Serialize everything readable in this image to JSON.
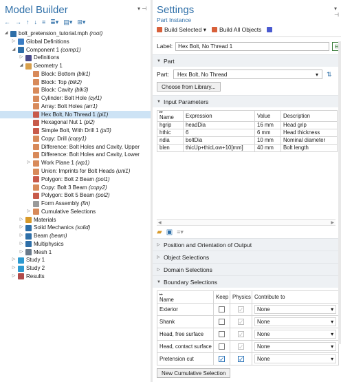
{
  "model_builder": {
    "title": "Model Builder",
    "toolbar": [
      "←",
      "→",
      "↑",
      "↓",
      "≡",
      "≣▾",
      "▤▾",
      "⊞▾"
    ],
    "tree": [
      {
        "label": "bolt_pretension_tutorial.mph",
        "tag": "(root)",
        "level": 0,
        "twisty": "◢",
        "icon": "mph-file-icon",
        "color": "#2e6fa8"
      },
      {
        "label": "Global Definitions",
        "tag": "",
        "level": 1,
        "twisty": "▷",
        "icon": "globe-icon",
        "color": "#3a7dc4"
      },
      {
        "label": "Component 1",
        "tag": "(comp1)",
        "level": 1,
        "twisty": "◢",
        "icon": "component-icon",
        "color": "#2e6fa8"
      },
      {
        "label": "Definitions",
        "tag": "",
        "level": 2,
        "twisty": "▷",
        "icon": "definitions-icon",
        "color": "#4a4a8a"
      },
      {
        "label": "Geometry 1",
        "tag": "",
        "level": 2,
        "twisty": "◢",
        "icon": "geometry-icon",
        "color": "#d8a04c"
      },
      {
        "label": "Block: Bottom",
        "tag": "(blk1)",
        "level": 3,
        "twisty": "",
        "icon": "block-icon",
        "color": "#d88a5a"
      },
      {
        "label": "Block: Top",
        "tag": "(blk2)",
        "level": 3,
        "twisty": "",
        "icon": "block-icon",
        "color": "#d88a5a"
      },
      {
        "label": "Block: Cavity",
        "tag": "(blk3)",
        "level": 3,
        "twisty": "",
        "icon": "block-icon",
        "color": "#d88a5a"
      },
      {
        "label": "Cylinder: Bolt Hole",
        "tag": "(cyl1)",
        "level": 3,
        "twisty": "",
        "icon": "cylinder-icon",
        "color": "#d88a5a"
      },
      {
        "label": "Array: Bolt Holes",
        "tag": "(arr1)",
        "level": 3,
        "twisty": "",
        "icon": "array-icon",
        "color": "#d88a5a"
      },
      {
        "label": "Hex Bolt, No Thread 1",
        "tag": "(pi1)",
        "level": 3,
        "twisty": "",
        "icon": "part-instance-icon",
        "color": "#c85a4a",
        "selected": true
      },
      {
        "label": "Hexagonal Nut 1",
        "tag": "(pi2)",
        "level": 3,
        "twisty": "",
        "icon": "part-instance-icon",
        "color": "#c85a4a"
      },
      {
        "label": "Simple Bolt, With Drill 1",
        "tag": "(pi3)",
        "level": 3,
        "twisty": "",
        "icon": "part-instance-icon",
        "color": "#c85a4a"
      },
      {
        "label": "Copy: Drill",
        "tag": "(copy1)",
        "level": 3,
        "twisty": "",
        "icon": "copy-icon",
        "color": "#d88a5a"
      },
      {
        "label": "Difference: Bolt Holes and Cavity, Upper",
        "tag": "",
        "level": 3,
        "twisty": "",
        "icon": "difference-icon",
        "color": "#d88a5a"
      },
      {
        "label": "Difference: Bolt Holes and Cavity, Lower",
        "tag": "",
        "level": 3,
        "twisty": "",
        "icon": "difference-icon",
        "color": "#d88a5a"
      },
      {
        "label": "Work Plane 1",
        "tag": "(wp1)",
        "level": 3,
        "twisty": "▷",
        "icon": "work-plane-icon",
        "color": "#d88a5a"
      },
      {
        "label": "Union: Imprints for Bolt Heads",
        "tag": "(uni1)",
        "level": 3,
        "twisty": "",
        "icon": "union-icon",
        "color": "#d88a5a"
      },
      {
        "label": "Polygon: Bolt 2 Beam",
        "tag": "(pol1)",
        "level": 3,
        "twisty": "",
        "icon": "polygon-icon",
        "color": "#c85a4a"
      },
      {
        "label": "Copy: Bolt 3 Beam",
        "tag": "(copy2)",
        "level": 3,
        "twisty": "",
        "icon": "copy-icon",
        "color": "#d88a5a"
      },
      {
        "label": "Polygon: Bolt 5 Beam",
        "tag": "(pol2)",
        "level": 3,
        "twisty": "",
        "icon": "polygon-icon",
        "color": "#c85a4a"
      },
      {
        "label": "Form Assembly",
        "tag": "(fin)",
        "level": 3,
        "twisty": "",
        "icon": "form-assembly-icon",
        "color": "#9a9a9a"
      },
      {
        "label": "Cumulative Selections",
        "tag": "",
        "level": 3,
        "twisty": "▷",
        "icon": "selections-icon",
        "color": "#d88a5a"
      },
      {
        "label": "Materials",
        "tag": "",
        "level": 2,
        "twisty": "▷",
        "icon": "materials-icon",
        "color": "#d89a2a"
      },
      {
        "label": "Solid Mechanics",
        "tag": "(solid)",
        "level": 2,
        "twisty": "▷",
        "icon": "solid-mechanics-icon",
        "color": "#2e6fa8"
      },
      {
        "label": "Beam",
        "tag": "(beam)",
        "level": 2,
        "twisty": "▷",
        "icon": "beam-icon",
        "color": "#2e6fa8"
      },
      {
        "label": "Multiphysics",
        "tag": "",
        "level": 2,
        "twisty": "▷",
        "icon": "multiphysics-icon",
        "color": "#2e6fa8"
      },
      {
        "label": "Mesh 1",
        "tag": "",
        "level": 2,
        "twisty": "▷",
        "icon": "mesh-icon",
        "color": "#6a7a8a"
      },
      {
        "label": "Study 1",
        "tag": "",
        "level": 1,
        "twisty": "▷",
        "icon": "study-icon",
        "color": "#2e9ad0"
      },
      {
        "label": "Study 2",
        "tag": "",
        "level": 1,
        "twisty": "▷",
        "icon": "study-icon",
        "color": "#2e9ad0"
      },
      {
        "label": "Results",
        "tag": "",
        "level": 1,
        "twisty": "▷",
        "icon": "results-icon",
        "color": "#b04a4a"
      }
    ]
  },
  "settings": {
    "title": "Settings",
    "subtitle": "Part Instance",
    "build_selected": "Build Selected",
    "build_all": "Build All Objects",
    "label_caption": "Label:",
    "label_value": "Hex Bolt, No Thread 1",
    "part_section": "Part",
    "part_caption": "Part:",
    "part_value": "Hex Bolt, No Thread",
    "choose_library": "Choose from Library...",
    "input_params_section": "Input Parameters",
    "params_columns": [
      "Name",
      "Expression",
      "Value",
      "Description"
    ],
    "params_rows": [
      [
        "hgrip",
        "headDia",
        "16 mm",
        "Head grip"
      ],
      [
        "hthic",
        "6",
        "6 mm",
        "Head thickness"
      ],
      [
        "ndia",
        "boltDia",
        "10 mm",
        "Nominal diameter"
      ],
      [
        "blen",
        "thicUp+thicLow+10[mm]",
        "40 mm",
        "Bolt length"
      ]
    ],
    "collapsed_sections": [
      "Position and Orientation of Output",
      "Object Selections",
      "Domain Selections"
    ],
    "boundary_section": "Boundary Selections",
    "boundary_columns": [
      "Name",
      "Keep",
      "Physics",
      "Contribute to"
    ],
    "boundary_rows": [
      {
        "name": "Exterior",
        "keep": false,
        "physics": false,
        "contribute": "None"
      },
      {
        "name": "Shank",
        "keep": false,
        "physics": false,
        "contribute": "None"
      },
      {
        "name": "Head, free surface",
        "keep": false,
        "physics": false,
        "contribute": "None"
      },
      {
        "name": "Head, contact surface",
        "keep": false,
        "physics": false,
        "contribute": "None"
      },
      {
        "name": "Pretension cut",
        "keep": true,
        "physics": true,
        "contribute": "None"
      }
    ],
    "new_cumulative": "New Cumulative Selection"
  },
  "colors": {
    "accent": "#2e6fa8",
    "selection": "#cde3f5",
    "section_bg": "#eef1f4"
  }
}
